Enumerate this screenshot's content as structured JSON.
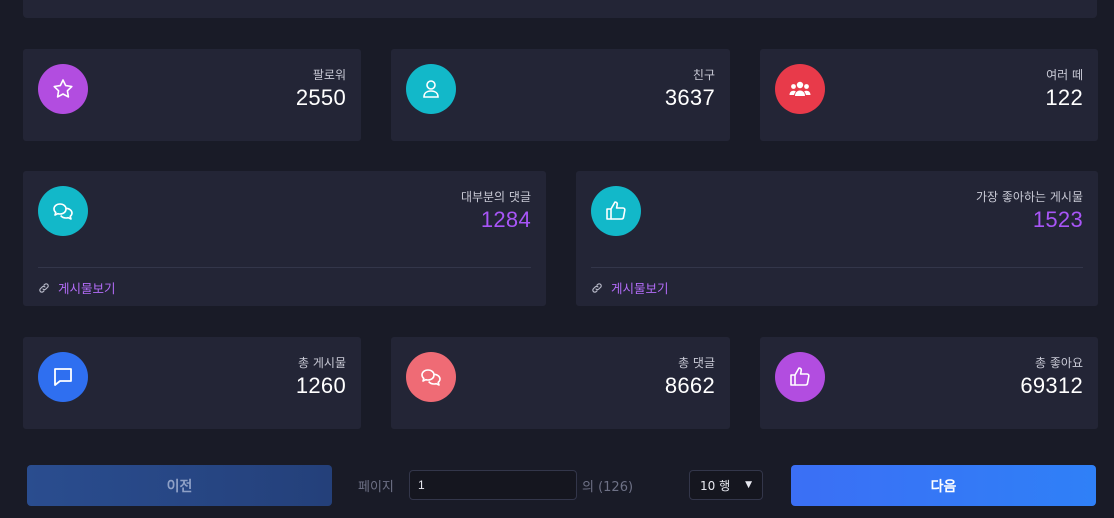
{
  "stats_top": [
    {
      "label": "팔로워",
      "value": "2550",
      "icon": "star-icon",
      "color": "#b24de0"
    },
    {
      "label": "친구",
      "value": "3637",
      "icon": "user-icon",
      "color": "#12b8c9"
    },
    {
      "label": "여러 떼",
      "value": "122",
      "icon": "users-icon",
      "color": "#e83a4a"
    }
  ],
  "stats_mid": [
    {
      "label": "대부분의 댓글",
      "value": "1284",
      "icon": "comments-icon",
      "color": "#12b8c9",
      "link": "게시물보기"
    },
    {
      "label": "가장 좋아하는 게시물",
      "value": "1523",
      "icon": "thumbs-up-icon",
      "color": "#12b8c9",
      "link": "게시물보기"
    }
  ],
  "stats_bottom": [
    {
      "label": "총 게시물",
      "value": "1260",
      "icon": "message-square-icon",
      "color": "#2f6ff0"
    },
    {
      "label": "총 댓글",
      "value": "8662",
      "icon": "comments-icon",
      "color": "#ef6b75"
    },
    {
      "label": "총 좋아요",
      "value": "69312",
      "icon": "thumbs-up-icon",
      "color": "#b24de0"
    }
  ],
  "pager": {
    "prev_label": "이전",
    "page_label": "페이지",
    "page_value": "1",
    "of_label": "의 (126)",
    "rows_value": "10 행",
    "next_label": "다음"
  }
}
